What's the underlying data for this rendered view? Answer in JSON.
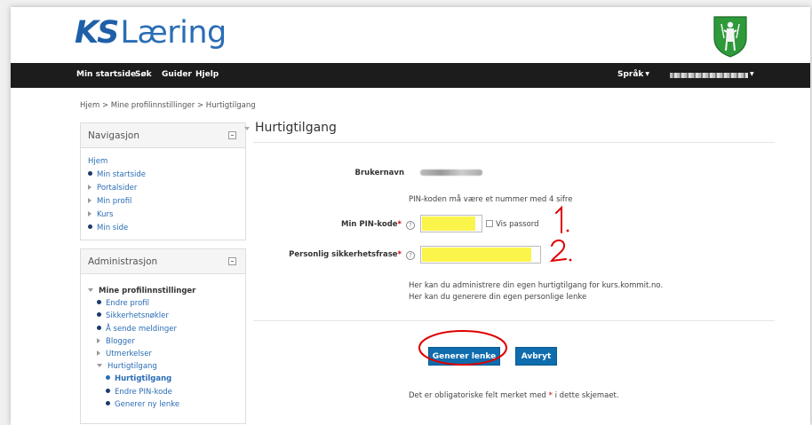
{
  "brand": {
    "ks": "KS",
    "name": "Læring"
  },
  "navbar": {
    "items": [
      "Min startside",
      "Søk",
      "Guider",
      "Hjelp"
    ],
    "language": "Språk"
  },
  "breadcrumb": "Hjem > Mine profilinnstillinger > Hurtigtilgang",
  "navigation": {
    "title": "Navigasjon",
    "home": "Hjem",
    "items": [
      "Min startside",
      "Portalsider",
      "Min profil",
      "Kurs",
      "Min side"
    ]
  },
  "administration": {
    "title": "Administrasjon",
    "group": "Mine profilinnstillinger",
    "items": [
      "Endre profil",
      "Sikkerhetsnøkler",
      "Å sende meldinger",
      "Blogger",
      "Utmerkelser",
      "Hurtigtilgang"
    ],
    "sub_items": [
      "Hurtigtilgang",
      "Endre PIN-kode",
      "Generer ny lenke"
    ]
  },
  "form": {
    "title": "Hurtigtilgang",
    "username_label": "Brukernavn",
    "pin_hint": "PIN-koden må være et nummer med 4 sifre",
    "pin_label": "Min PIN-kode",
    "show_password": "Vis passord",
    "phrase_label": "Personlig sikkerhetsfrase",
    "info_line1": "Her kan du administrere din egen hurtigtilgang for kurs.kommit.no.",
    "info_line2": "Her kan du generere din egen personlige lenke",
    "generate_button": "Generer lenke",
    "cancel_button": "Avbryt",
    "required_note_pre": "Det er obligatoriske felt merket med",
    "required_note_post": "i dette skjemaet.",
    "required_mark": "*"
  },
  "annotations": {
    "one": "1.",
    "two": "2."
  },
  "colors": {
    "accent": "#2a6db5",
    "navbar_bg": "#1c1c1c",
    "button": "#0f6cad",
    "highlight": "#fbf44b",
    "annotation_red": "#e00000",
    "required": "#cc0000"
  }
}
